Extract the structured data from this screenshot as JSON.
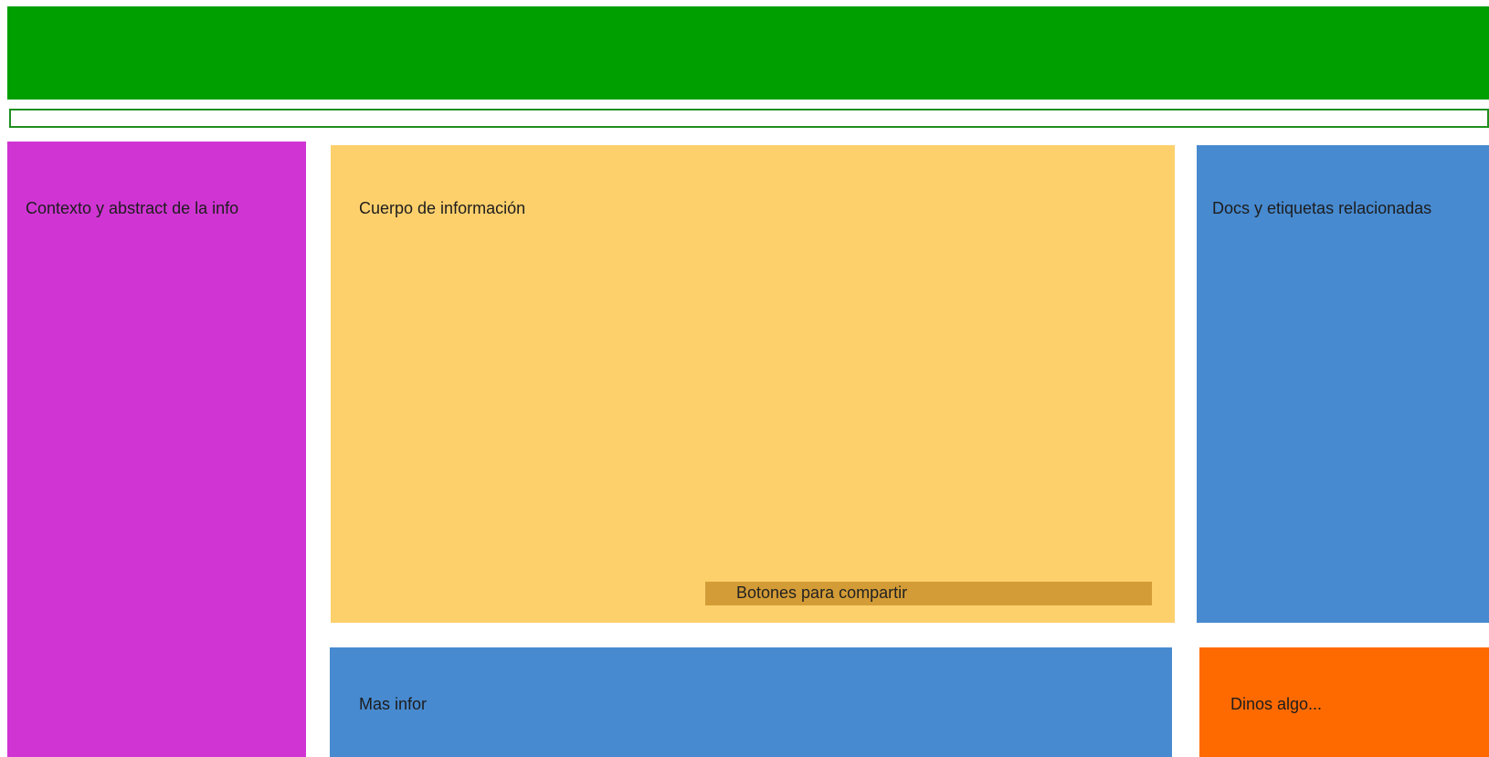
{
  "header": {
    "color": "#009f00"
  },
  "nav": {
    "border_color": "#1f8f1f"
  },
  "panels": {
    "context": {
      "label": "Contexto y abstract de la info",
      "color": "#d035d3"
    },
    "body": {
      "label": "Cuerpo de información",
      "color": "#fdd06c"
    },
    "share": {
      "label": "Botones para compartir",
      "color": "#d49c36"
    },
    "related": {
      "label": "Docs y etiquetas relacionadas",
      "color": "#478ad0"
    },
    "more_info": {
      "label": "Mas infor",
      "color": "#478ad0"
    },
    "feedback": {
      "label": "Dinos algo...",
      "color": "#ff6a00"
    }
  }
}
